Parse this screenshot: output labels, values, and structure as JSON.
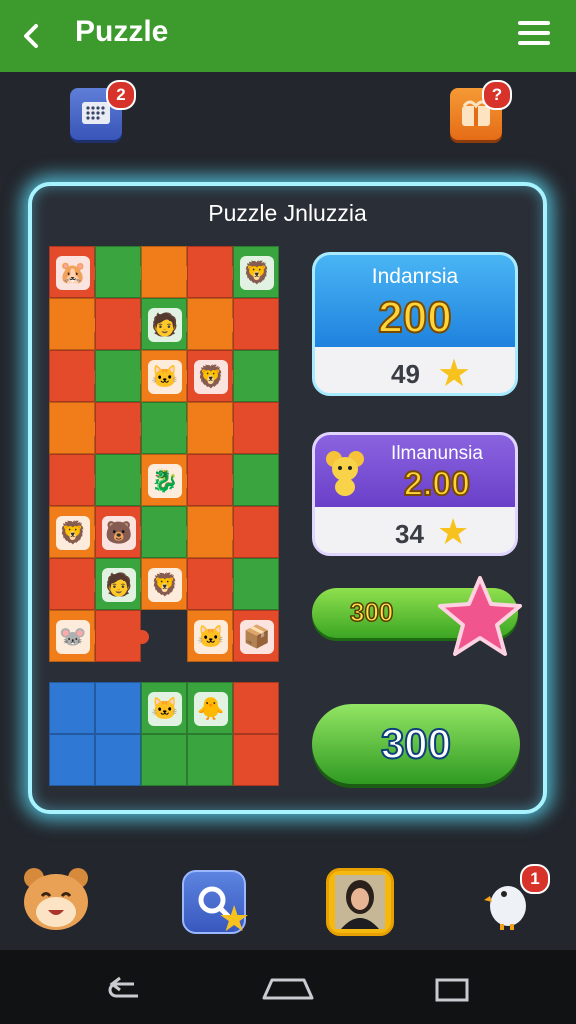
{
  "topbar": {
    "title": "Puzzle",
    "back_icon": "chevron-left-icon",
    "menu_icon": "hamburger-menu-icon",
    "color": "#3d9a2c"
  },
  "top_icons": {
    "messages": {
      "icon": "domino-chat-icon",
      "badge": "2"
    },
    "gift": {
      "icon": "gift-box-icon",
      "badge": "?"
    }
  },
  "panel": {
    "title": "Puzzle Jnluzzia",
    "glow_color": "#a7f3ff"
  },
  "cards": [
    {
      "name": "Indanrsia",
      "value": "200",
      "sub_value": "49",
      "star_icon": "star-icon"
    },
    {
      "name": "Ilmanunsia",
      "value": "2.00",
      "sub_value": "34",
      "avatar_icon": "mouse-mascot-icon",
      "star_icon": "star-icon"
    }
  ],
  "bar": {
    "value": "300",
    "star_icon": "pink-star-icon"
  },
  "big_button": {
    "label": "300"
  },
  "dock": [
    {
      "name": "hamster-avatar-icon"
    },
    {
      "name": "search-icon",
      "badge_icon": "star-icon"
    },
    {
      "name": "player-portrait-icon"
    },
    {
      "name": "bird-icon",
      "badge": "1"
    }
  ],
  "nav": {
    "back": "nav-back-icon",
    "home": "nav-home-icon",
    "recent": "nav-recent-icon"
  }
}
